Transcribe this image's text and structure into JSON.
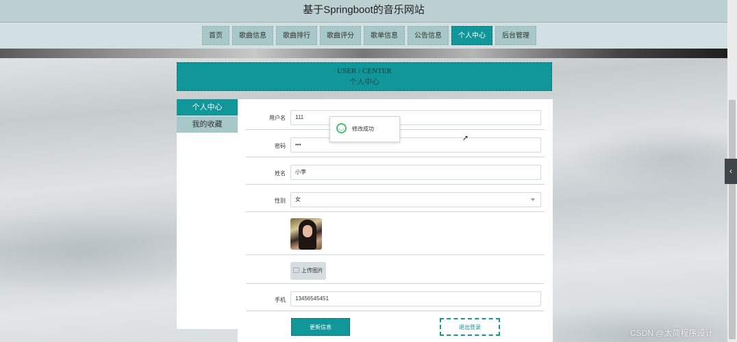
{
  "site": {
    "title": "基于Springboot的音乐网站"
  },
  "nav": {
    "items": [
      {
        "label": "首页"
      },
      {
        "label": "歌曲信息"
      },
      {
        "label": "歌曲排行"
      },
      {
        "label": "歌曲评分"
      },
      {
        "label": "歌单信息"
      },
      {
        "label": "公告信息"
      },
      {
        "label": "个人中心",
        "active": true
      },
      {
        "label": "后台管理"
      }
    ]
  },
  "section_header": {
    "en": "USER / CENTER",
    "zh": "个人中心"
  },
  "sidebar": {
    "items": [
      {
        "label": "个人中心",
        "active": true
      },
      {
        "label": "我的收藏"
      }
    ]
  },
  "form": {
    "username": {
      "label": "用户名",
      "value": "111"
    },
    "password": {
      "label": "密码",
      "value": "•••"
    },
    "name": {
      "label": "姓名",
      "value": "小李"
    },
    "gender": {
      "label": "性别",
      "value": "女"
    },
    "upload_label": "上传图片",
    "phone": {
      "label": "手机",
      "value": "13456545451"
    },
    "update_label": "更新信息",
    "logout_label": "退出登录"
  },
  "toast": {
    "message": "修改成功"
  },
  "watermark": "CSDN @太简程序设计",
  "colors": {
    "accent": "#11969a",
    "nav_bg": "#a8c7c8",
    "toast_icon": "#4cba6c"
  }
}
